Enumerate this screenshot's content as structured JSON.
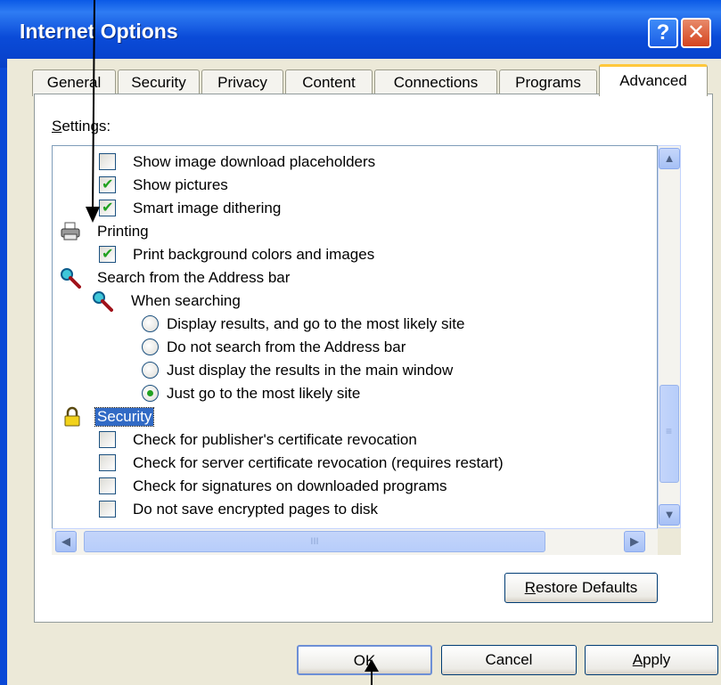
{
  "window": {
    "title": "Internet Options",
    "help_glyph": "?",
    "close_glyph": "✕"
  },
  "tabs": [
    {
      "label": "General"
    },
    {
      "label": "Security"
    },
    {
      "label": "Privacy"
    },
    {
      "label": "Content"
    },
    {
      "label": "Connections"
    },
    {
      "label": "Programs"
    },
    {
      "label": "Advanced",
      "active": true
    }
  ],
  "settings_label_first": "S",
  "settings_label_rest": "ettings:",
  "settings": {
    "items": [
      {
        "type": "checkbox",
        "label": "Show image download placeholders",
        "checked": false
      },
      {
        "type": "checkbox",
        "label": "Show pictures",
        "checked": true
      },
      {
        "type": "checkbox",
        "label": "Smart image dithering",
        "checked": true
      },
      {
        "type": "category",
        "label": "Printing",
        "icon": "printer-icon"
      },
      {
        "type": "checkbox",
        "label": "Print background colors and images",
        "checked": true
      },
      {
        "type": "category",
        "label": "Search from the Address bar",
        "icon": "magnifier-icon"
      },
      {
        "type": "subcategory",
        "label": "When searching",
        "icon": "magnifier-icon"
      },
      {
        "type": "radio",
        "label": "Display results, and go to the most likely site",
        "checked": false
      },
      {
        "type": "radio",
        "label": "Do not search from the Address bar",
        "checked": false
      },
      {
        "type": "radio",
        "label": "Just display the results in the main window",
        "checked": false
      },
      {
        "type": "radio",
        "label": "Just go to the most likely site",
        "checked": true
      },
      {
        "type": "category",
        "label": "Security",
        "icon": "lock-icon",
        "selected": true
      },
      {
        "type": "checkbox",
        "label": "Check for publisher's certificate revocation",
        "checked": false
      },
      {
        "type": "checkbox",
        "label": "Check for server certificate revocation (requires restart)",
        "checked": false
      },
      {
        "type": "checkbox",
        "label": "Check for signatures on downloaded programs",
        "checked": false
      },
      {
        "type": "checkbox",
        "label": "Do not save encrypted pages to disk",
        "checked": false
      }
    ],
    "check_glyph": "✔"
  },
  "scroll": {
    "up": "▲",
    "down": "▼",
    "left": "◀",
    "right": "▶",
    "grip_v": "≡",
    "grip_h": "III"
  },
  "buttons": {
    "restore_first": "R",
    "restore_rest": "estore Defaults",
    "ok": "OK",
    "cancel": "Cancel",
    "apply_first": "A",
    "apply_rest": "pply"
  },
  "colors": {
    "title_bar": "#0a4bd8",
    "dialog_face": "#ece9d8",
    "selection": "#316ac5",
    "check": "#21a121"
  }
}
